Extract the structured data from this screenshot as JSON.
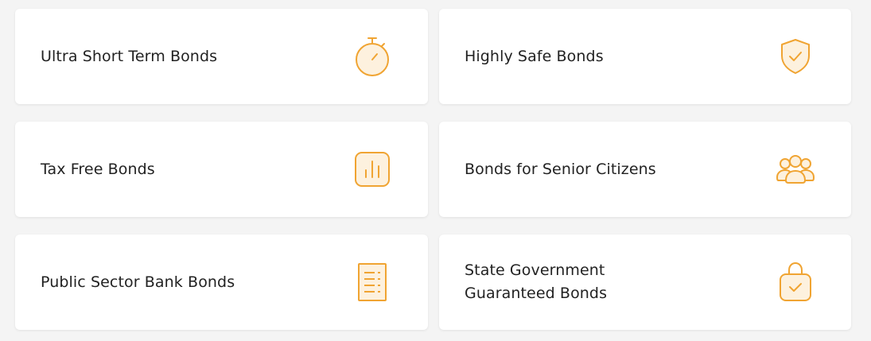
{
  "accent_color": "#f0a432",
  "icon_fill_color": "#fdf1de",
  "cards": [
    {
      "label": "Ultra Short Term Bonds",
      "icon": "stopwatch-icon"
    },
    {
      "label": "Highly Safe Bonds",
      "icon": "shield-check-icon"
    },
    {
      "label": "Tax Free Bonds",
      "icon": "bar-chart-icon"
    },
    {
      "label": "Bonds for Senior Citizens",
      "icon": "people-group-icon"
    },
    {
      "label": "Public Sector Bank Bonds",
      "icon": "document-list-icon"
    },
    {
      "label": "State Government\nGuaranteed Bonds",
      "icon": "bag-check-icon"
    }
  ]
}
